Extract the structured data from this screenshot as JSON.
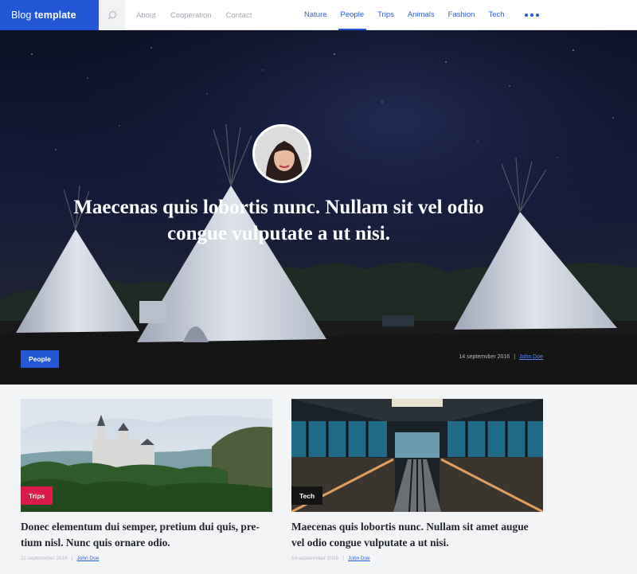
{
  "brand": {
    "part1": "Blog",
    "part2": "template"
  },
  "nav_left": [
    "About",
    "Cooperation",
    "Contact"
  ],
  "nav_right": [
    "Nature",
    "People",
    "Trips",
    "Animals",
    "Fashion",
    "Tech"
  ],
  "active_nav": "People",
  "hero": {
    "title": "Maecenas quis lobortis nunc. Nullam sit vel odio congue vulputate a ut nisi.",
    "category": "People",
    "date": "14 septemvber 2016",
    "separator": "|",
    "author": "John Doe"
  },
  "cards": [
    {
      "category": "Trips",
      "category_color": "#d81b4a",
      "title": "Donec elementum dui semper, pretium dui quis, pre- tium nisl. Nunc quis ornare odio.",
      "date": "11 septemvber 2016",
      "separator": "|",
      "author": "John Doe"
    },
    {
      "category": "Tech",
      "category_color": "#141414",
      "title": "Maecenas quis lobortis nunc. Nullam sit amet augue vel odio congue vulputate a ut nisi.",
      "date": "14 septemvber 2016",
      "separator": "|",
      "author": "John Doe"
    }
  ],
  "colors": {
    "accent": "#2457d6",
    "trips": "#d81b4a",
    "tech": "#141414"
  }
}
